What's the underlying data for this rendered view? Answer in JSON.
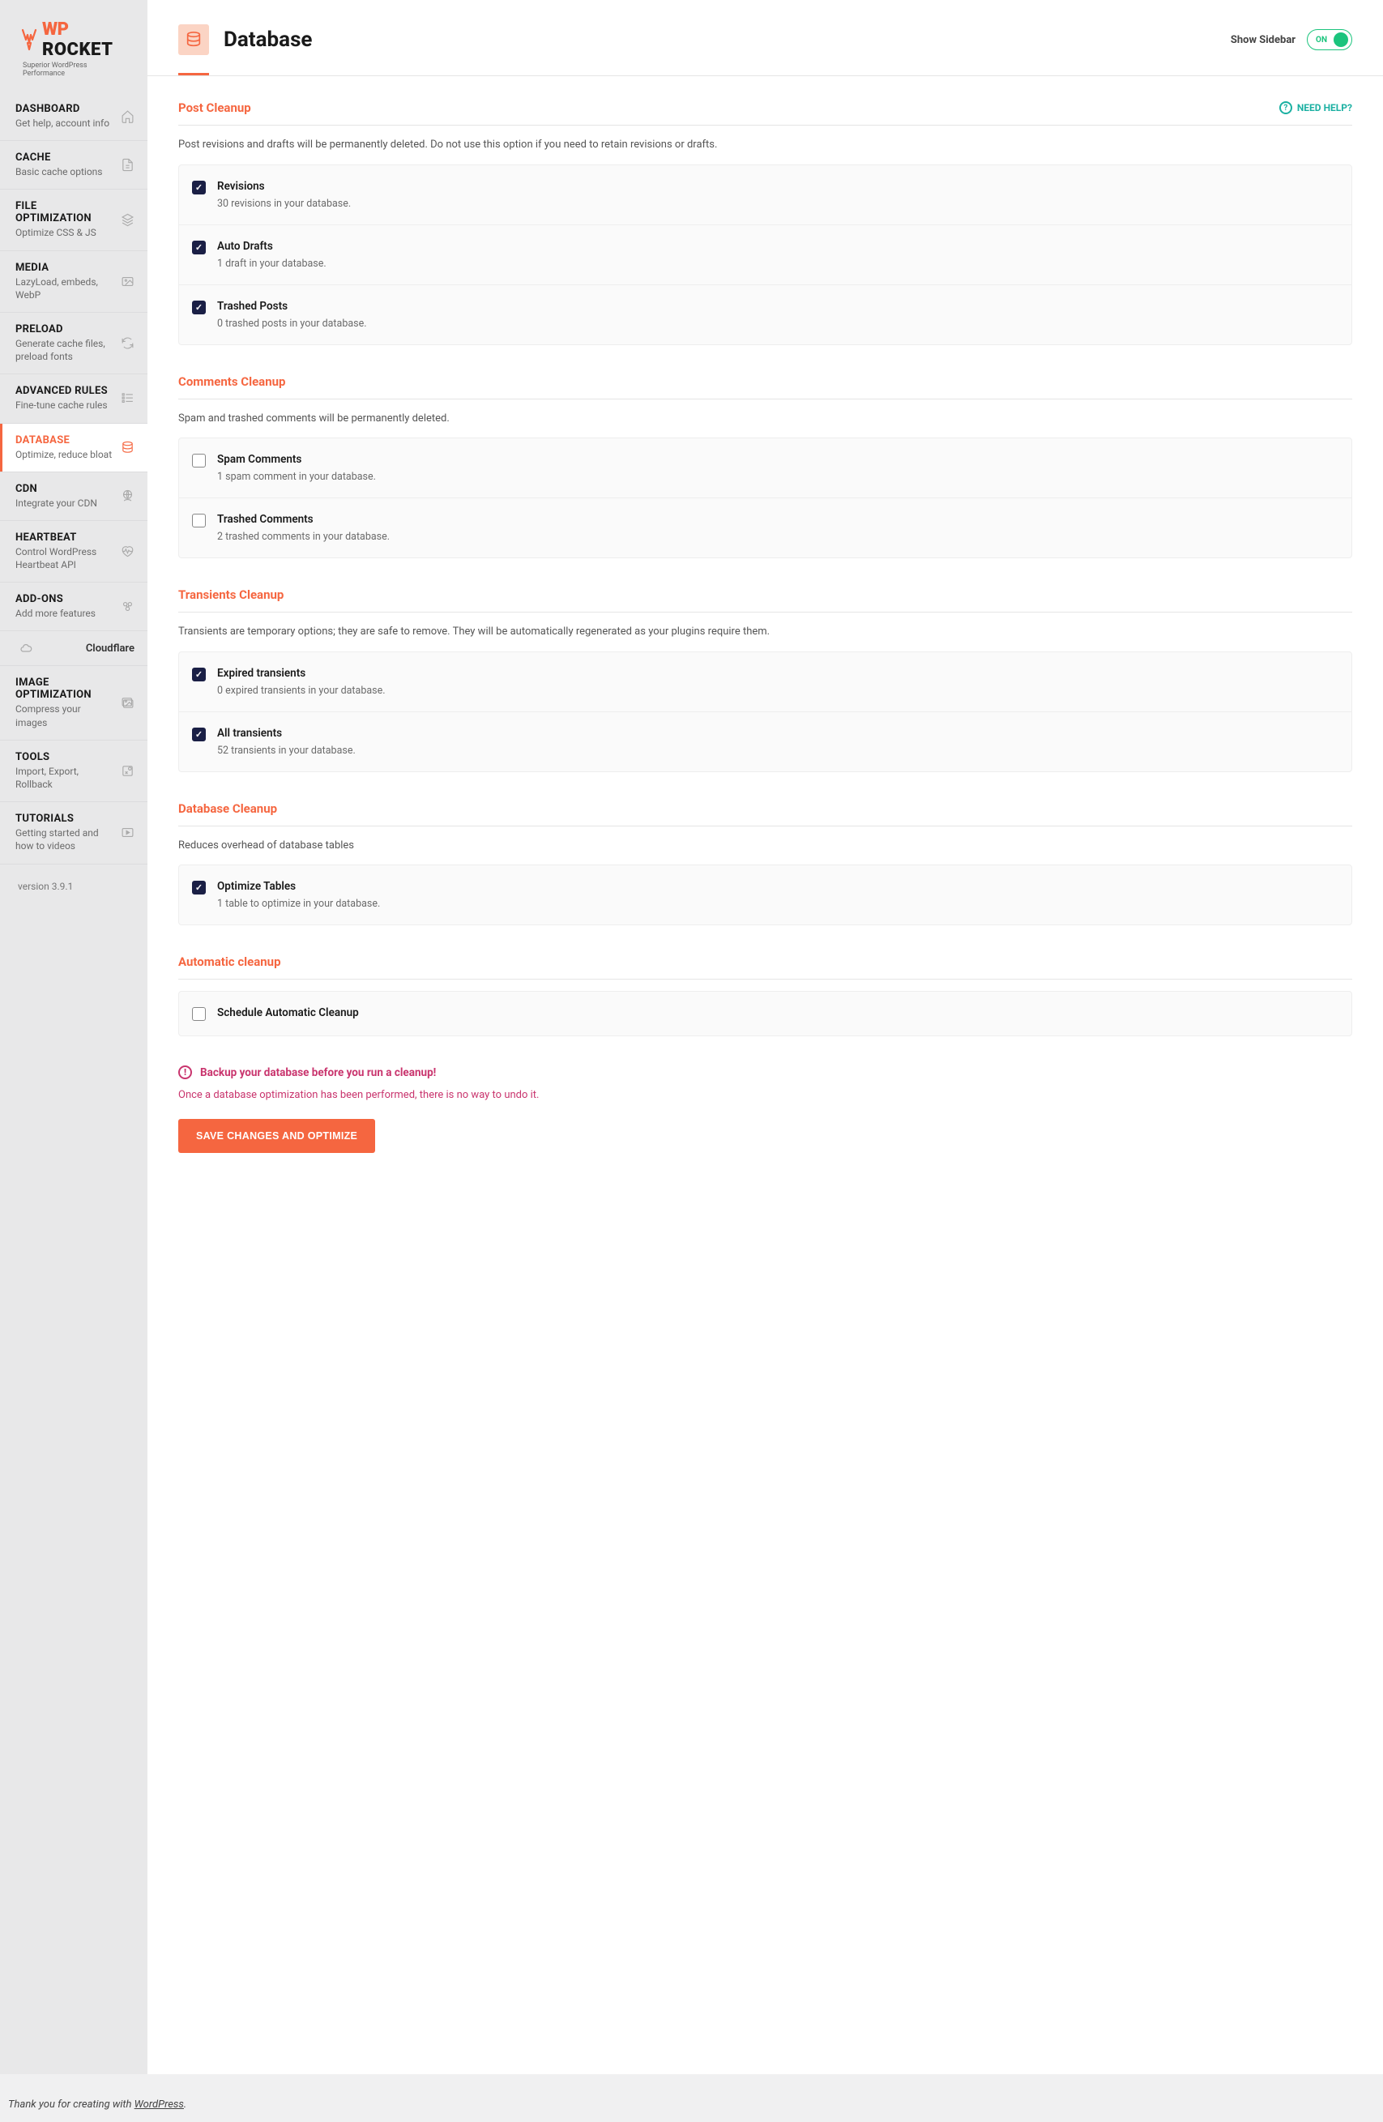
{
  "logo": {
    "prefix": "WP",
    "suffix": "ROCKET",
    "tagline": "Superior WordPress Performance"
  },
  "sidebar": {
    "items": [
      {
        "title": "DASHBOARD",
        "desc": "Get help, account info",
        "active": false,
        "icon": "home"
      },
      {
        "title": "CACHE",
        "desc": "Basic cache options",
        "active": false,
        "icon": "file"
      },
      {
        "title": "FILE OPTIMIZATION",
        "desc": "Optimize CSS & JS",
        "active": false,
        "icon": "layers"
      },
      {
        "title": "MEDIA",
        "desc": "LazyLoad, embeds, WebP",
        "active": false,
        "icon": "image"
      },
      {
        "title": "PRELOAD",
        "desc": "Generate cache files, preload fonts",
        "active": false,
        "icon": "refresh"
      },
      {
        "title": "ADVANCED RULES",
        "desc": "Fine-tune cache rules",
        "active": false,
        "icon": "list"
      },
      {
        "title": "DATABASE",
        "desc": "Optimize, reduce bloat",
        "active": true,
        "icon": "database"
      },
      {
        "title": "CDN",
        "desc": "Integrate your CDN",
        "active": false,
        "icon": "globe"
      },
      {
        "title": "HEARTBEAT",
        "desc": "Control WordPress Heartbeat API",
        "active": false,
        "icon": "heartbeat"
      },
      {
        "title": "ADD-ONS",
        "desc": "Add more features",
        "active": false,
        "icon": "puzzle"
      }
    ],
    "sub_cloudflare": "Cloudflare",
    "items2": [
      {
        "title": "IMAGE OPTIMIZATION",
        "desc": "Compress your images",
        "active": false,
        "icon": "images"
      },
      {
        "title": "TOOLS",
        "desc": "Import, Export, Rollback",
        "active": false,
        "icon": "tools"
      },
      {
        "title": "TUTORIALS",
        "desc": "Getting started and how to videos",
        "active": false,
        "icon": "play"
      }
    ]
  },
  "version": "version 3.9.1",
  "header": {
    "title": "Database",
    "show_sidebar": "Show Sidebar",
    "toggle": "ON"
  },
  "help_link": "NEED HELP?",
  "sections": {
    "post_cleanup": {
      "title": "Post Cleanup",
      "desc": "Post revisions and drafts will be permanently deleted. Do not use this option if you need to retain revisions or drafts.",
      "options": [
        {
          "label": "Revisions",
          "sub": "30 revisions in your database.",
          "checked": true
        },
        {
          "label": "Auto Drafts",
          "sub": "1 draft in your database.",
          "checked": true
        },
        {
          "label": "Trashed Posts",
          "sub": "0 trashed posts in your database.",
          "checked": true
        }
      ]
    },
    "comments_cleanup": {
      "title": "Comments Cleanup",
      "desc": "Spam and trashed comments will be permanently deleted.",
      "options": [
        {
          "label": "Spam Comments",
          "sub": "1 spam comment in your database.",
          "checked": false
        },
        {
          "label": "Trashed Comments",
          "sub": "2 trashed comments in your database.",
          "checked": false
        }
      ]
    },
    "transients_cleanup": {
      "title": "Transients Cleanup",
      "desc": "Transients are temporary options; they are safe to remove. They will be automatically regenerated as your plugins require them.",
      "options": [
        {
          "label": "Expired transients",
          "sub": "0 expired transients in your database.",
          "checked": true
        },
        {
          "label": "All transients",
          "sub": "52 transients in your database.",
          "checked": true
        }
      ]
    },
    "database_cleanup": {
      "title": "Database Cleanup",
      "desc": "Reduces overhead of database tables",
      "options": [
        {
          "label": "Optimize Tables",
          "sub": "1 table to optimize in your database.",
          "checked": true
        }
      ]
    },
    "automatic_cleanup": {
      "title": "Automatic cleanup",
      "options": [
        {
          "label": "Schedule Automatic Cleanup",
          "sub": "",
          "checked": false
        }
      ]
    }
  },
  "warning": {
    "title": "Backup your database before you run a cleanup!",
    "desc": "Once a database optimization has been performed, there is no way to undo it."
  },
  "save_button": "SAVE CHANGES AND OPTIMIZE",
  "footer": {
    "text": "Thank you for creating with ",
    "link": "WordPress"
  }
}
